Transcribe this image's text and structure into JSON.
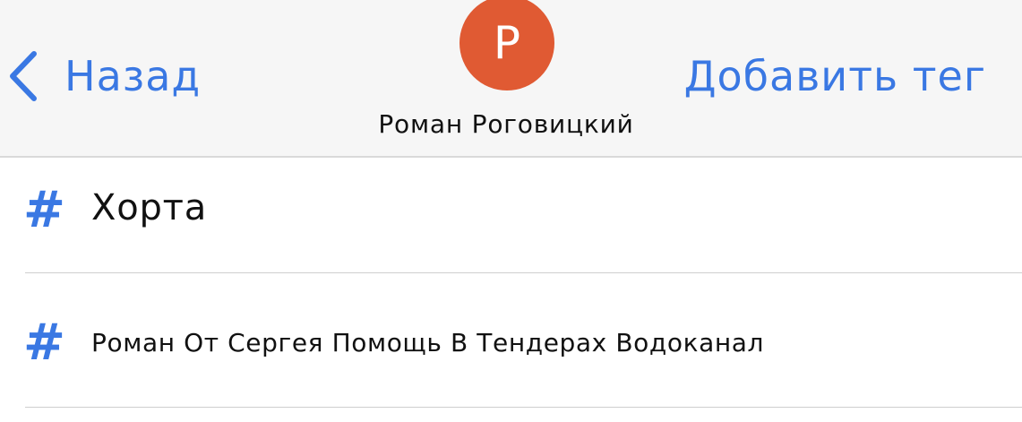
{
  "header": {
    "back_label": "Назад",
    "avatar_initial": "Р",
    "contact_name": "Роман Роговицкий",
    "add_tag_label": "Добавить тег"
  },
  "tags": [
    {
      "icon": "hash-icon",
      "symbol": "#",
      "label": "Хорта"
    },
    {
      "icon": "hash-icon",
      "symbol": "#",
      "label": "Роман От Сергея Помощь В Тендерах Водоканал"
    }
  ],
  "colors": {
    "accent": "#3a78e3",
    "avatar_bg": "#e05a33",
    "navbar_bg": "#f6f6f6"
  }
}
